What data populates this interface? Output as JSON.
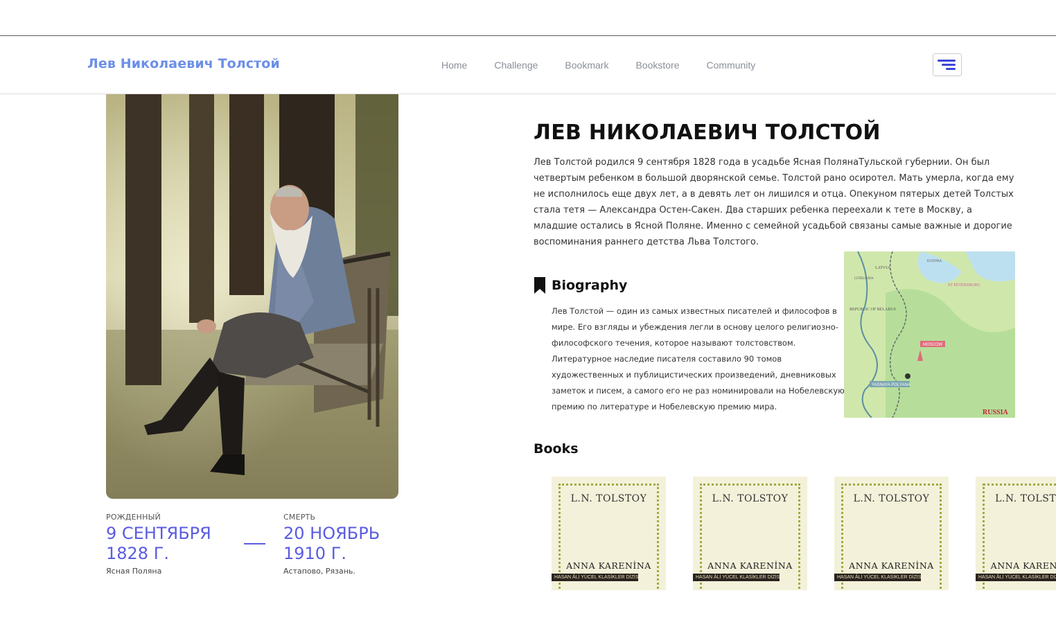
{
  "header": {
    "brand": "Лев Николаевич Толстой",
    "nav": [
      {
        "label": "Home"
      },
      {
        "label": "Challenge"
      },
      {
        "label": "Bookmark"
      },
      {
        "label": "Bookstore"
      },
      {
        "label": "Community"
      }
    ],
    "menu_icon": "hamburger-menu-icon"
  },
  "profile": {
    "born_caption": "РОЖДЕННЫЙ",
    "born_date": "9 СЕНТЯБРЯ 1828 Г.",
    "born_place": "Ясная Поляна",
    "death_caption": "СМЕРТЬ",
    "death_date": "20 НОЯБРЬ 1910 Г.",
    "death_place": "Астапово, Рязань."
  },
  "main": {
    "title": "ЛЕВ НИКОЛАЕВИЧ ТОЛСТОЙ",
    "intro": "Лев Толстой родился 9 сентября 1828 года в усадьбе Ясная ПолянаТульской губернии. Он был четвертым ребенком в большой дворянской семье. Толстой рано осиротел. Мать умерла, когда ему не исполнилось еще двух лет, а в девять лет он лишился и отца. Опекуном пятерых детей Толстых стала тетя — Александра Остен-Сакен. Два старших ребенка переехали к тете в Москву, а младшие остались в Ясной Поляне. Именно с семейной усадьбой связаны самые важные и дорогие воспоминания раннего детства Льва Толстого.",
    "biography_heading": "Biography",
    "biography_icon": "bookmark-icon",
    "biography_text": "Лев Толстой — один из самых известных писателей и философов в мире. Его взгляды и убеждения легли в основу целого религиозно-философского течения, которое называют толстовством. Литературное наследие писателя составило 90 томов художественных и публицистических произведений, дневниковых заметок и писем, а самого его не раз номинировали на Нобелевскую премию по литературе и Нобелевскую премию мира.",
    "map_labels": {
      "latvia": "LATVIA",
      "estonia": "ESTONIA",
      "lithuania": "LITHUANIA",
      "st_petersburg": "ST PETERSBURG",
      "belarus": "REPUBLIC OF BELARUS",
      "moscow": "MOSCOW",
      "yasnaya": "YASNAYA POLYANA",
      "russiapedia": "RUSSIA"
    },
    "books_heading": "Books",
    "books": [
      {
        "author": "L.N. TOLSTOY",
        "title": "ANNA KARENİNA",
        "series": "HASAN ÂLİ YÜCEL KLASİKLER DİZİSİ"
      },
      {
        "author": "L.N. TOLSTOY",
        "title": "ANNA KARENİNA",
        "series": "HASAN ÂLİ YÜCEL KLASİKLER DİZİSİ"
      },
      {
        "author": "L.N. TOLSTOY",
        "title": "ANNA KARENİNA",
        "series": "HASAN ÂLİ YÜCEL KLASİKLER DİZİSİ"
      },
      {
        "author": "L.N. TOLSTOY",
        "title": "ANNA KARENİNA",
        "series": "HASAN ÂLİ YÜCEL KLASİKLER DİZİSİ"
      }
    ]
  }
}
